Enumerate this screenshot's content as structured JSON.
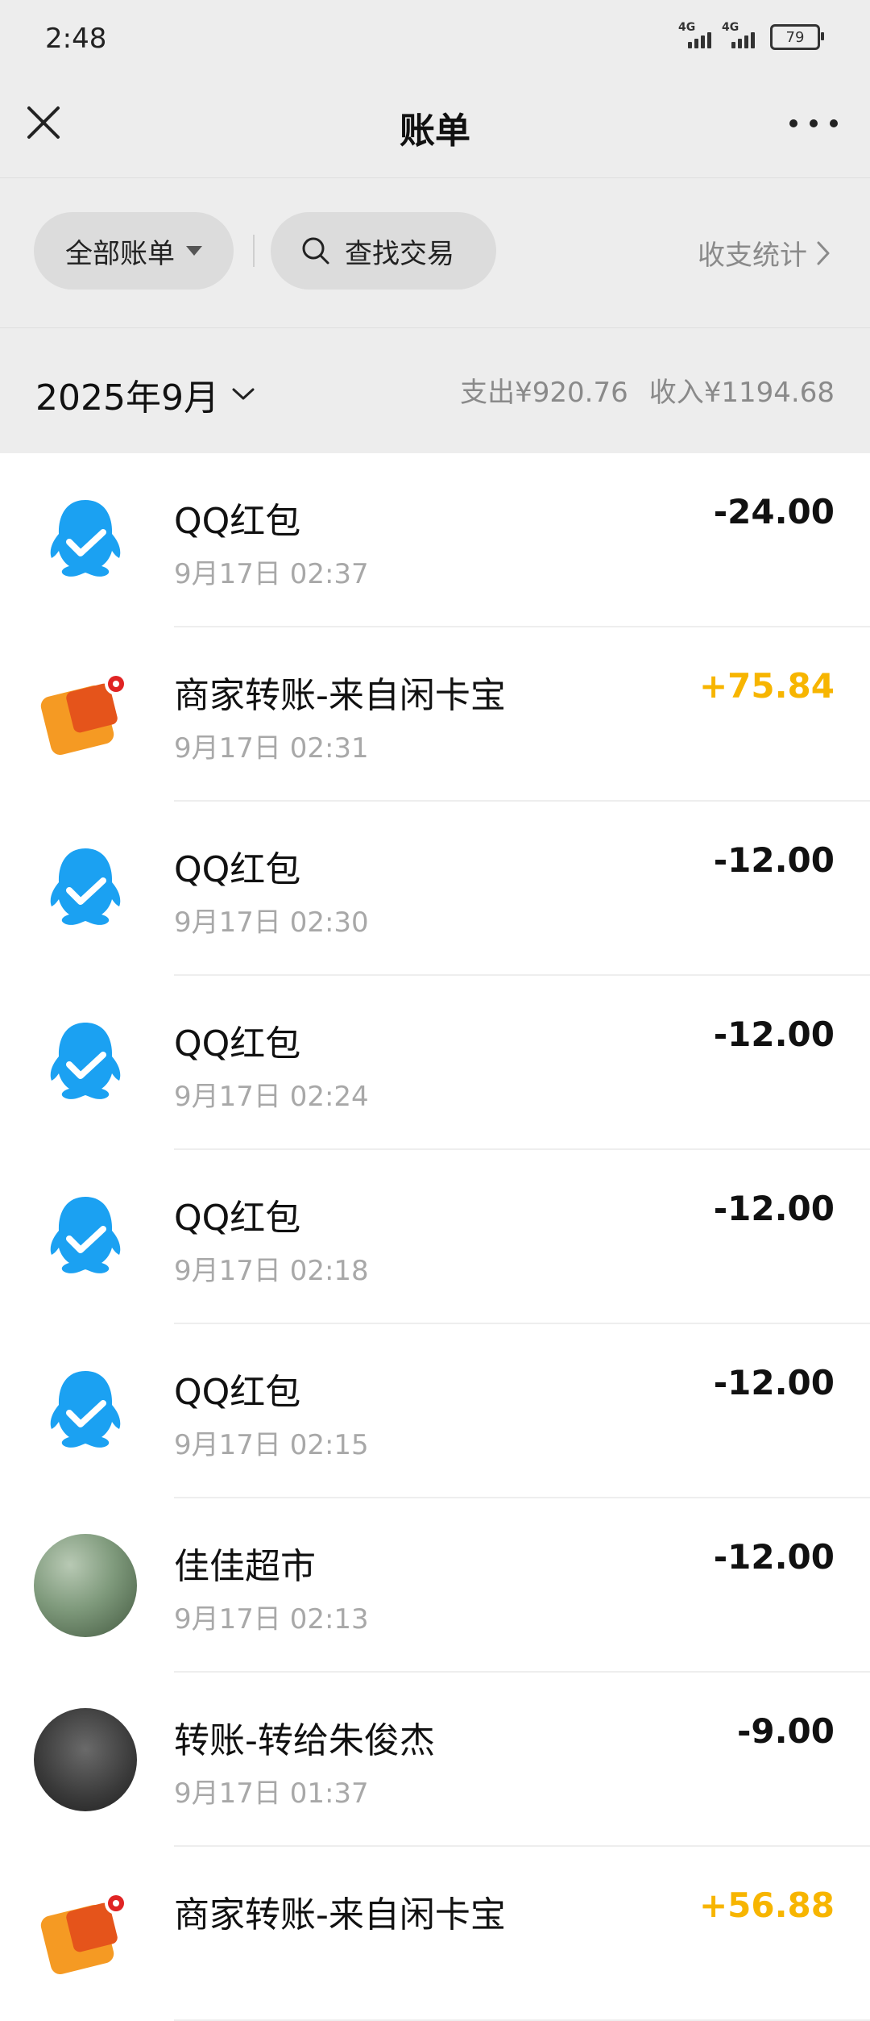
{
  "status_bar": {
    "time": "2:48",
    "network_1": "4G",
    "network_2": "4G",
    "battery": "79"
  },
  "nav": {
    "title": "账单",
    "close_icon": "close-icon",
    "more_icon": "more-icon"
  },
  "filters": {
    "all_bills": "全部账单",
    "search": "查找交易",
    "stats": "收支统计"
  },
  "month": {
    "label": "2025年9月",
    "expense": "支出¥920.76",
    "income": "收入¥1194.68"
  },
  "colors": {
    "income": "#f7b500",
    "qq_blue": "#1ba1f2",
    "wallet_orange": "#f59a23"
  },
  "transactions": [
    {
      "title": "QQ红包",
      "time": "9月17日 02:37",
      "amount": "-24.00",
      "type": "expense",
      "icon": "qq-icon"
    },
    {
      "title": "商家转账-来自闲卡宝",
      "time": "9月17日 02:31",
      "amount": "+75.84",
      "type": "income",
      "icon": "merchant-wallet-icon"
    },
    {
      "title": "QQ红包",
      "time": "9月17日 02:30",
      "amount": "-12.00",
      "type": "expense",
      "icon": "qq-icon"
    },
    {
      "title": "QQ红包",
      "time": "9月17日 02:24",
      "amount": "-12.00",
      "type": "expense",
      "icon": "qq-icon"
    },
    {
      "title": "QQ红包",
      "time": "9月17日 02:18",
      "amount": "-12.00",
      "type": "expense",
      "icon": "qq-icon"
    },
    {
      "title": "QQ红包",
      "time": "9月17日 02:15",
      "amount": "-12.00",
      "type": "expense",
      "icon": "qq-icon"
    },
    {
      "title": "佳佳超市",
      "time": "9月17日 02:13",
      "amount": "-12.00",
      "type": "expense",
      "icon": "store-avatar"
    },
    {
      "title": "转账-转给朱俊杰",
      "time": "9月17日 01:37",
      "amount": "-9.00",
      "type": "expense",
      "icon": "person-avatar"
    },
    {
      "title": "商家转账-来自闲卡宝",
      "time": "",
      "amount": "+56.88",
      "type": "income",
      "icon": "merchant-wallet-icon"
    }
  ]
}
